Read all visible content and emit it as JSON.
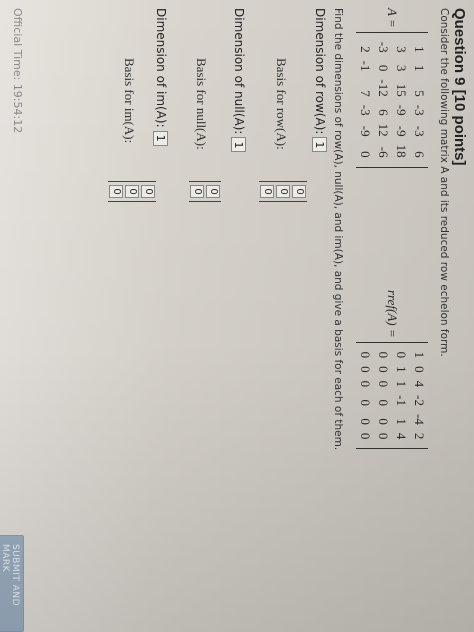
{
  "question": {
    "title": "Question 9 [10 points]",
    "intro": "Consider the following matrix A and its reduced row echelon form.",
    "matrix_label": "A =",
    "rref_label": "rref(A) =",
    "matrix_A": [
      [
        "1",
        "1",
        "5",
        "-3",
        "-3",
        "6"
      ],
      [
        "3",
        "3",
        "15",
        "-9",
        "-9",
        "18"
      ],
      [
        "-3",
        "0",
        "-12",
        "6",
        "12",
        "-6"
      ],
      [
        "2",
        "-1",
        "7",
        "-3",
        "-9",
        "0"
      ]
    ],
    "rref_A": [
      [
        "1",
        "0",
        "4",
        "-2",
        "-4",
        "2"
      ],
      [
        "0",
        "1",
        "1",
        "-1",
        "1",
        "4"
      ],
      [
        "0",
        "0",
        "0",
        "0",
        "0",
        "0"
      ],
      [
        "0",
        "0",
        "0",
        "0",
        "0",
        "0"
      ]
    ],
    "find_text": "Find the dimensions of row(A), null(A), and im(A), and give a basis for each of them.",
    "dim_row_label": "Dimension of row(A):",
    "dim_row_value": "1",
    "basis_row_label": "Basis for row(A):",
    "basis_row_vector": [
      "0",
      "0",
      "0"
    ],
    "dim_null_label": "Dimension of null(A):",
    "dim_null_value": "1",
    "basis_null_label": "Basis for null(A):",
    "basis_null_vector": [
      "0",
      "0"
    ],
    "dim_im_label": "Dimension of im(A):",
    "dim_im_value": "1",
    "basis_im_label": "Basis for im(A):",
    "basis_im_vector": [
      "0",
      "0",
      "0"
    ]
  },
  "footer": {
    "timer": "Official Time: 19:54:12",
    "submit_label": "SUBMIT AND MARK"
  }
}
